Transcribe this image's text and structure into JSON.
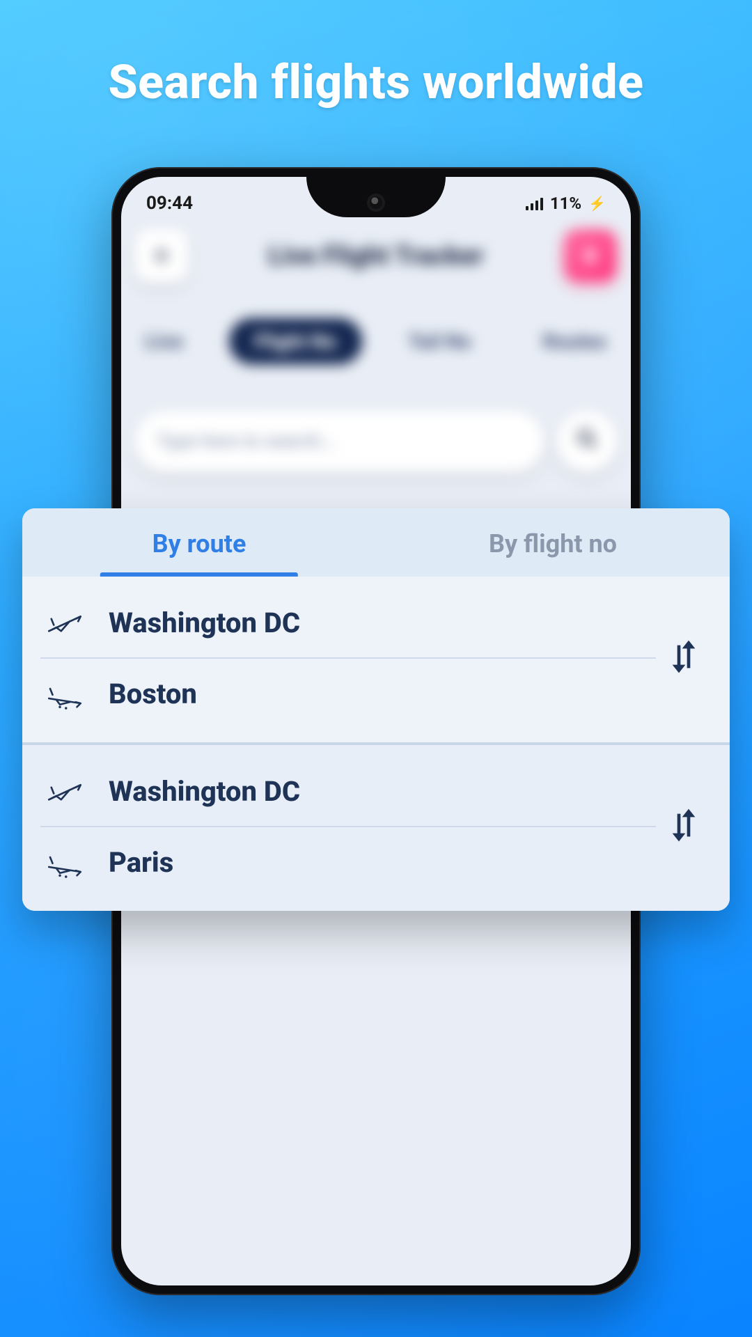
{
  "headline": "Search flights worldwide",
  "statusbar": {
    "time": "09:44",
    "battery_text": "11%"
  },
  "app": {
    "title": "Live Flight Tracker",
    "tabs": {
      "live": "Live",
      "flight_no": "Flight No",
      "tail_no": "Tail No",
      "routes": "Routes"
    },
    "search_placeholder": "Type here to search..."
  },
  "overlay": {
    "tabs": {
      "by_route": "By route",
      "by_flight_no": "By flight no",
      "active": "by_route"
    },
    "groups": [
      {
        "from": "Washington DC",
        "to": "Boston"
      },
      {
        "from": "Washington DC",
        "to": "Paris"
      }
    ]
  },
  "icons": {
    "menu": "menu-icon",
    "crown": "crown-icon",
    "search": "search-icon",
    "plane_takeoff": "plane-takeoff-icon",
    "plane_landing": "plane-landing-icon",
    "swap": "swap-vertical-icon",
    "signal": "cellular-signal-icon",
    "charging": "charging-icon"
  },
  "colors": {
    "accent": "#2f7fe6",
    "navy": "#1e3356",
    "bg_gradient_from": "#4ac9ff",
    "bg_gradient_to": "#0a84ff",
    "crown_gradient_from": "#ff6a9e",
    "crown_gradient_to": "#ff3d7f"
  }
}
